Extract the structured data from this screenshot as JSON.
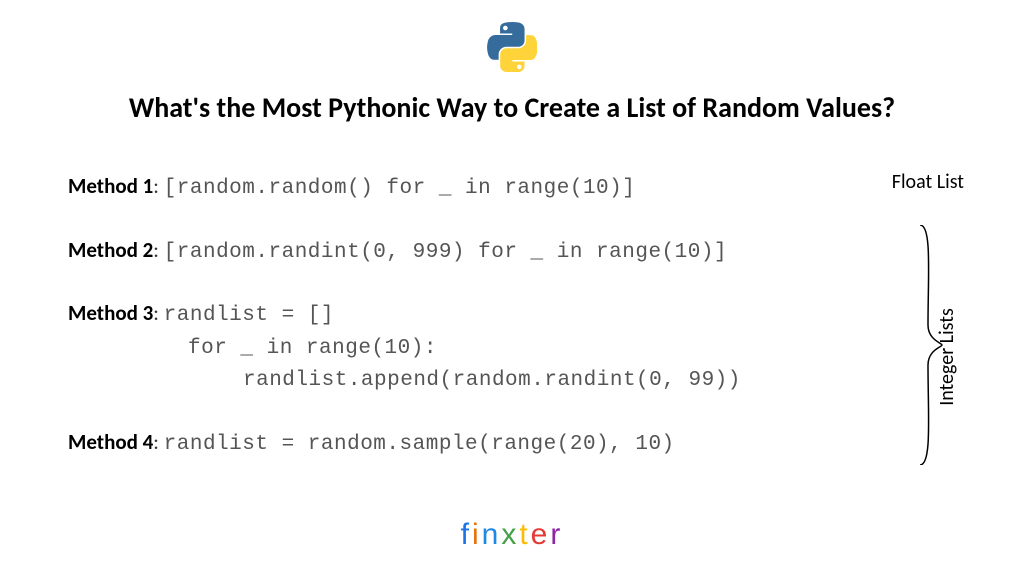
{
  "title": "What's the Most Pythonic Way to Create a List of Random Values?",
  "methods": [
    {
      "label": "Method 1",
      "code": "[random.random() for _ in range(10)]"
    },
    {
      "label": "Method 2",
      "code": "[random.randint(0, 999) for _ in range(10)]"
    },
    {
      "label": "Method 3",
      "code_line1": "randlist = []",
      "code_line2": "for _ in range(10):",
      "code_line3": "randlist.append(random.randint(0, 99))"
    },
    {
      "label": "Method 4",
      "code": "randlist = random.sample(range(20), 10)"
    }
  ],
  "annotations": {
    "float_list": "Float List",
    "integer_lists": "Integer Lists"
  },
  "brand": {
    "letters": [
      "f",
      "i",
      "n",
      "x",
      "t",
      "e",
      "r"
    ]
  }
}
